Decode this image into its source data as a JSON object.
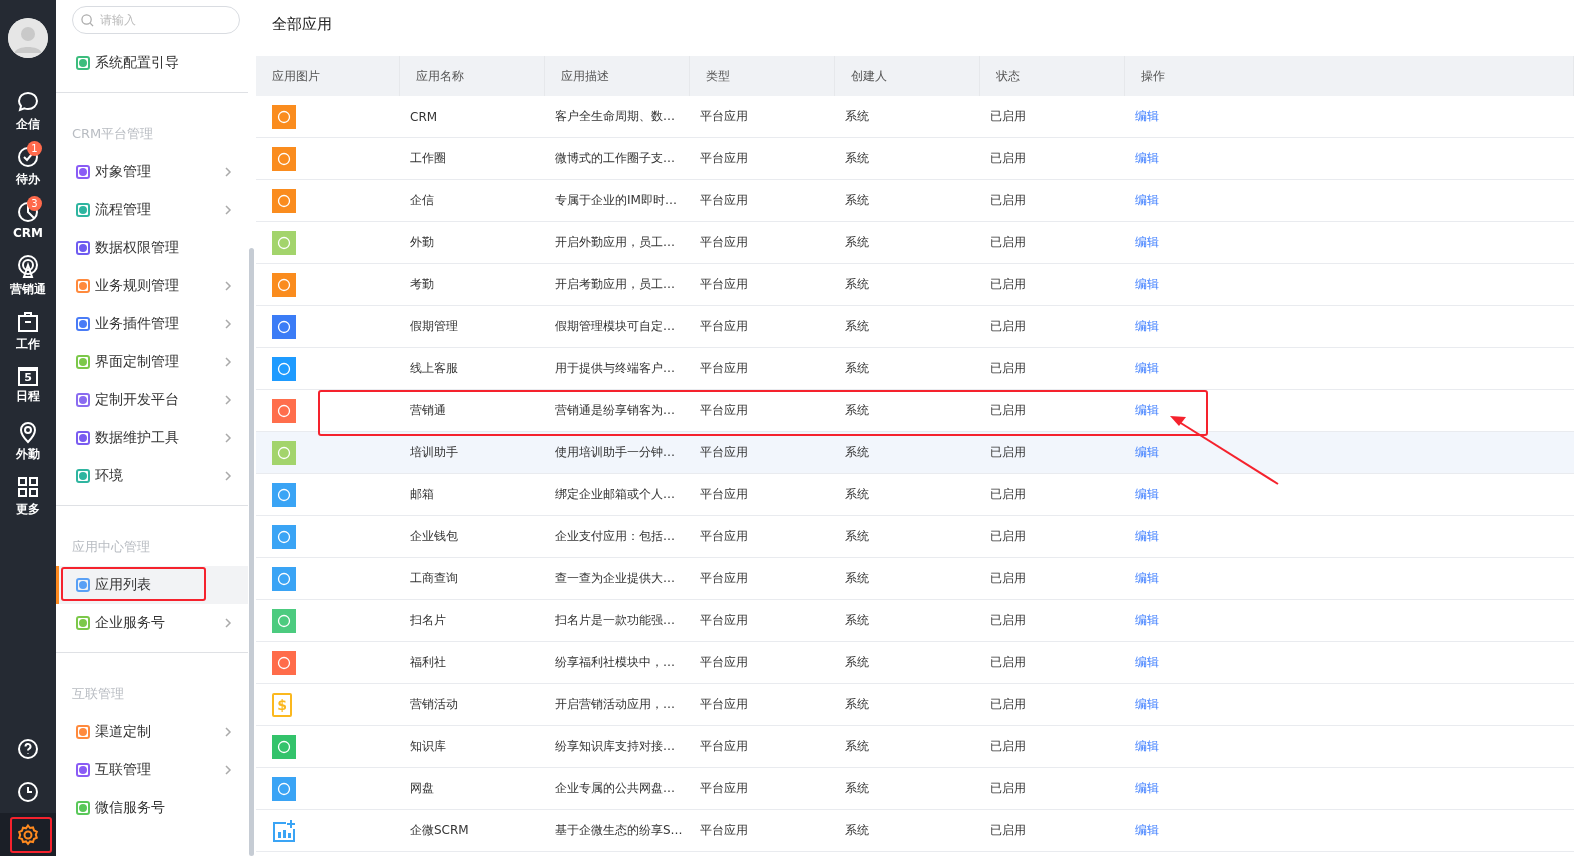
{
  "rail": {
    "items": [
      {
        "kind": "chat",
        "label": "企信"
      },
      {
        "kind": "check",
        "label": "待办",
        "badge": "1"
      },
      {
        "kind": "pie",
        "label": "CRM",
        "badge": "3"
      },
      {
        "kind": "broadcast",
        "label": "营销通"
      },
      {
        "kind": "briefcase",
        "label": "工作"
      },
      {
        "kind": "calendar",
        "label": "日程",
        "icon_text": "5"
      },
      {
        "kind": "pin",
        "label": "外勤"
      },
      {
        "kind": "grid",
        "label": "更多"
      }
    ],
    "bottom": [
      {
        "kind": "help",
        "selected": false,
        "annotated": false
      },
      {
        "kind": "history",
        "selected": false,
        "annotated": false
      },
      {
        "kind": "settings",
        "selected": true,
        "annotated": true
      }
    ]
  },
  "sidebar": {
    "search": {
      "placeholder": "请输入"
    },
    "sections": [
      {
        "items": [
          {
            "label": "系统配置引导",
            "color": "#3dbd7d",
            "has_submenu": false,
            "selected": false,
            "annotated": false
          }
        ]
      },
      {
        "title": "CRM平台管理",
        "items": [
          {
            "label": "对象管理",
            "color": "#8a5cf5",
            "has_submenu": true,
            "selected": false,
            "annotated": false
          },
          {
            "label": "流程管理",
            "color": "#2fb5a0",
            "has_submenu": true,
            "selected": false,
            "annotated": false
          },
          {
            "label": "数据权限管理",
            "color": "#6f5cf0",
            "has_submenu": false,
            "selected": false,
            "annotated": false
          },
          {
            "label": "业务规则管理",
            "color": "#ff8a3d",
            "has_submenu": true,
            "selected": false,
            "annotated": false
          },
          {
            "label": "业务插件管理",
            "color": "#4a7cf6",
            "has_submenu": true,
            "selected": false,
            "annotated": false
          },
          {
            "label": "界面定制管理",
            "color": "#7cc84a",
            "has_submenu": true,
            "selected": false,
            "annotated": false
          },
          {
            "label": "定制开发平台",
            "color": "#8a6cf0",
            "has_submenu": true,
            "selected": false,
            "annotated": false
          },
          {
            "label": "数据维护工具",
            "color": "#7a5cf0",
            "has_submenu": true,
            "selected": false,
            "annotated": false
          },
          {
            "label": "环境",
            "color": "#2fb5a0",
            "has_submenu": true,
            "selected": false,
            "annotated": false
          }
        ]
      },
      {
        "title": "应用中心管理",
        "items": [
          {
            "label": "应用列表",
            "color": "#5aa0f5",
            "has_submenu": false,
            "selected": true,
            "annotated": true
          },
          {
            "label": "企业服务号",
            "color": "#7cc84a",
            "has_submenu": true,
            "selected": false,
            "annotated": false
          }
        ]
      },
      {
        "title": "互联管理",
        "items": [
          {
            "label": "渠道定制",
            "color": "#ff8a3d",
            "has_submenu": true,
            "selected": false,
            "annotated": false
          },
          {
            "label": "互联管理",
            "color": "#8a5cf5",
            "has_submenu": true,
            "selected": false,
            "annotated": false
          },
          {
            "label": "微信服务号",
            "color": "#5ac85a",
            "has_submenu": false,
            "selected": false,
            "annotated": false
          }
        ]
      }
    ]
  },
  "page": {
    "title": "全部应用"
  },
  "table": {
    "columns": [
      "应用图片",
      "应用名称",
      "应用描述",
      "类型",
      "创建人",
      "状态",
      "操作"
    ],
    "rows": [
      {
        "icon": {
          "kind": "tile",
          "color": "#fa8c1e"
        },
        "name": "CRM",
        "description": "客户全生命周期、数…",
        "type": "平台应用",
        "creator": "系统",
        "status": "已启用",
        "action": "编辑",
        "hovered": false,
        "annotated": false
      },
      {
        "icon": {
          "kind": "tile",
          "color": "#fa8c1e"
        },
        "name": "工作圈",
        "description": "微博式的工作圈子支…",
        "type": "平台应用",
        "creator": "系统",
        "status": "已启用",
        "action": "编辑",
        "hovered": false,
        "annotated": false
      },
      {
        "icon": {
          "kind": "tile",
          "color": "#fa8c1e"
        },
        "name": "企信",
        "description": "专属于企业的IM即时…",
        "type": "平台应用",
        "creator": "系统",
        "status": "已启用",
        "action": "编辑",
        "hovered": false,
        "annotated": false
      },
      {
        "icon": {
          "kind": "tile",
          "color": "#a3d46c"
        },
        "name": "外勤",
        "description": "开启外勤应用，员工…",
        "type": "平台应用",
        "creator": "系统",
        "status": "已启用",
        "action": "编辑",
        "hovered": false,
        "annotated": false
      },
      {
        "icon": {
          "kind": "tile",
          "color": "#fa8c1e"
        },
        "name": "考勤",
        "description": "开启考勤应用，员工…",
        "type": "平台应用",
        "creator": "系统",
        "status": "已启用",
        "action": "编辑",
        "hovered": false,
        "annotated": false
      },
      {
        "icon": {
          "kind": "tile",
          "color": "#3b7cf6"
        },
        "name": "假期管理",
        "description": "假期管理模块可自定…",
        "type": "平台应用",
        "creator": "系统",
        "status": "已启用",
        "action": "编辑",
        "hovered": false,
        "annotated": false
      },
      {
        "icon": {
          "kind": "tile",
          "color": "#1e9bff"
        },
        "name": "线上客服",
        "description": "用于提供与终端客户…",
        "type": "平台应用",
        "creator": "系统",
        "status": "已启用",
        "action": "编辑",
        "hovered": false,
        "annotated": false
      },
      {
        "icon": {
          "kind": "tile",
          "color": "#ff6e4c"
        },
        "name": "营销通",
        "description": "营销通是纷享销客为…",
        "type": "平台应用",
        "creator": "系统",
        "status": "已启用",
        "action": "编辑",
        "hovered": false,
        "annotated": true
      },
      {
        "icon": {
          "kind": "tile",
          "color": "#a3d46c"
        },
        "name": "培训助手",
        "description": "使用培训助手一分钟…",
        "type": "平台应用",
        "creator": "系统",
        "status": "已启用",
        "action": "编辑",
        "hovered": true,
        "annotated": false
      },
      {
        "icon": {
          "kind": "tile",
          "color": "#3aa4f5"
        },
        "name": "邮箱",
        "description": "绑定企业邮箱或个人…",
        "type": "平台应用",
        "creator": "系统",
        "status": "已启用",
        "action": "编辑",
        "hovered": false,
        "annotated": false
      },
      {
        "icon": {
          "kind": "tile",
          "color": "#3aa4f5"
        },
        "name": "企业钱包",
        "description": "企业支付应用：包括…",
        "type": "平台应用",
        "creator": "系统",
        "status": "已启用",
        "action": "编辑",
        "hovered": false,
        "annotated": false
      },
      {
        "icon": {
          "kind": "tile",
          "color": "#3aa4f5"
        },
        "name": "工商查询",
        "description": "查一查为企业提供大…",
        "type": "平台应用",
        "creator": "系统",
        "status": "已启用",
        "action": "编辑",
        "hovered": false,
        "annotated": false
      },
      {
        "icon": {
          "kind": "tile",
          "color": "#4ccb7f"
        },
        "name": "扫名片",
        "description": "扫名片是一款功能强…",
        "type": "平台应用",
        "creator": "系统",
        "status": "已启用",
        "action": "编辑",
        "hovered": false,
        "annotated": false
      },
      {
        "icon": {
          "kind": "tile",
          "color": "#ff6c4a"
        },
        "name": "福利社",
        "description": "纷享福利社模块中，…",
        "type": "平台应用",
        "creator": "系统",
        "status": "已启用",
        "action": "编辑",
        "hovered": false,
        "annotated": false
      },
      {
        "icon": {
          "kind": "document",
          "color": "#fbb81e",
          "icon_text": "$"
        },
        "name": "营销活动",
        "description": "开启营销活动应用，…",
        "type": "平台应用",
        "creator": "系统",
        "status": "已启用",
        "action": "编辑",
        "hovered": false,
        "annotated": false
      },
      {
        "icon": {
          "kind": "tile",
          "color": "#33c36b"
        },
        "name": "知识库",
        "description": "纷享知识库支持对接…",
        "type": "平台应用",
        "creator": "系统",
        "status": "已启用",
        "action": "编辑",
        "hovered": false,
        "annotated": false
      },
      {
        "icon": {
          "kind": "tile",
          "color": "#3aa4f5"
        },
        "name": "网盘",
        "description": "企业专属的公共网盘…",
        "type": "平台应用",
        "creator": "系统",
        "status": "已启用",
        "action": "编辑",
        "hovered": false,
        "annotated": false
      },
      {
        "icon": {
          "kind": "chart",
          "color": "#3aa4f5"
        },
        "name": "企微SCRM",
        "description": "基于企微生态的纷享S…",
        "type": "平台应用",
        "creator": "系统",
        "status": "已启用",
        "action": "编辑",
        "hovered": false,
        "annotated": false
      }
    ]
  }
}
